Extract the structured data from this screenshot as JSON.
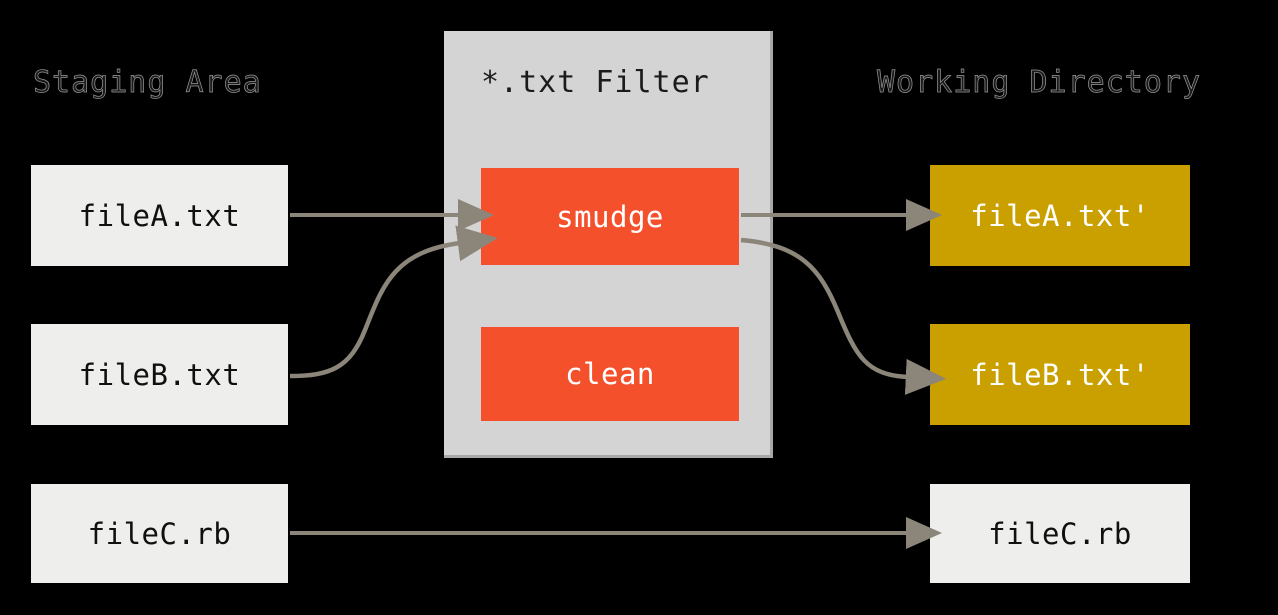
{
  "diagram": {
    "title": "*.txt Filter smudge and clean flow",
    "background_color": "#000000",
    "arrow_color": "#8c8579"
  },
  "columns": {
    "staging": {
      "title": "Staging Area"
    },
    "filter": {
      "title": "*.txt Filter",
      "panel_color": "#d4d4d4"
    },
    "working": {
      "title": "Working Directory"
    }
  },
  "staging_files": [
    {
      "label": "fileA.txt",
      "color": "#eeeeec",
      "text_color": "#101010"
    },
    {
      "label": "fileB.txt",
      "color": "#eeeeec",
      "text_color": "#101010"
    },
    {
      "label": "fileC.rb",
      "color": "#eeeeec",
      "text_color": "#101010"
    }
  ],
  "filters": [
    {
      "label": "smudge",
      "color": "#f4502c",
      "text_color": "#ffffff"
    },
    {
      "label": "clean",
      "color": "#f4502c",
      "text_color": "#ffffff"
    }
  ],
  "working_files": [
    {
      "label": "fileA.txt'",
      "color": "#c9a000",
      "text_color": "#ffffff"
    },
    {
      "label": "fileB.txt'",
      "color": "#c9a000",
      "text_color": "#ffffff"
    },
    {
      "label": "fileC.rb",
      "color": "#eeeeec",
      "text_color": "#101010"
    }
  ],
  "connections": [
    {
      "from": "fileA.txt",
      "to": "smudge",
      "shape": "straight"
    },
    {
      "from": "fileB.txt",
      "to": "smudge",
      "shape": "curved"
    },
    {
      "from": "smudge",
      "to": "fileA.txt'",
      "shape": "straight"
    },
    {
      "from": "smudge",
      "to": "fileB.txt'",
      "shape": "curved"
    },
    {
      "from": "fileC.rb",
      "to": "fileC.rb",
      "shape": "straight"
    }
  ]
}
